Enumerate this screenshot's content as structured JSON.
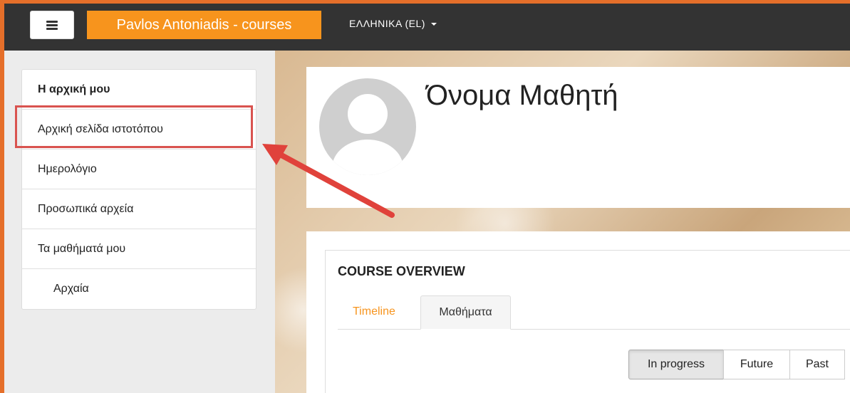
{
  "navbar": {
    "brand": "Pavlos Antoniadis - courses",
    "language": "ΕΛΛΗΝΙΚΑ (EL)"
  },
  "sidebar": {
    "items": [
      {
        "label": "Η αρχική μου"
      },
      {
        "label": "Αρχική σελίδα ιστοτόπου"
      },
      {
        "label": "Ημερολόγιο"
      },
      {
        "label": "Προσωπικά αρχεία"
      },
      {
        "label": "Τα μαθήματά μου"
      },
      {
        "label": "Αρχαία"
      }
    ]
  },
  "profile": {
    "name": "Όνομα Μαθητή"
  },
  "overview": {
    "title": "COURSE OVERVIEW",
    "tabs": [
      {
        "label": "Timeline"
      },
      {
        "label": "Μαθήματα"
      }
    ],
    "filters": [
      {
        "label": "In progress"
      },
      {
        "label": "Future"
      },
      {
        "label": "Past"
      }
    ]
  },
  "colors": {
    "accent": "#f7941d",
    "navbar": "#333333",
    "highlight": "#d9534f",
    "frame": "#e56f2a"
  }
}
